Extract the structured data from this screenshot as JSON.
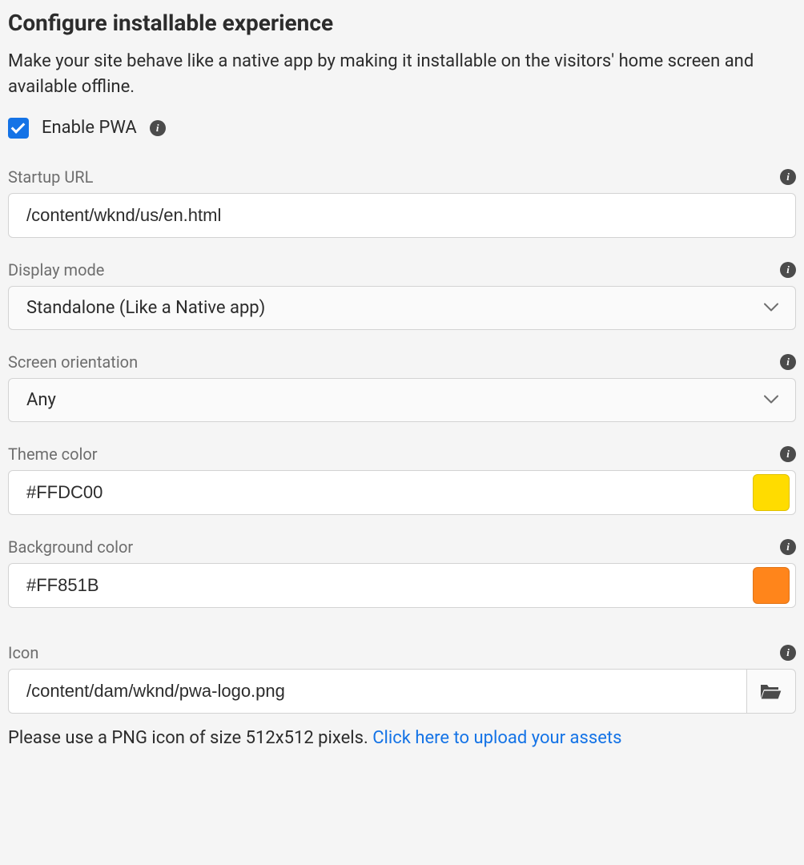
{
  "header": {
    "title": "Configure installable experience",
    "description": "Make your site behave like a native app by making it installable on the visitors' home screen and available offline."
  },
  "enable": {
    "label": "Enable PWA",
    "checked": true
  },
  "fields": {
    "startup_url": {
      "label": "Startup URL",
      "value": "/content/wknd/us/en.html"
    },
    "display_mode": {
      "label": "Display mode",
      "value": "Standalone (Like a Native app)"
    },
    "screen_orientation": {
      "label": "Screen orientation",
      "value": "Any"
    },
    "theme_color": {
      "label": "Theme color",
      "value": "#FFDC00",
      "swatch": "#FFDC00"
    },
    "background_color": {
      "label": "Background color",
      "value": "#FF851B",
      "swatch": "#FF851B"
    },
    "icon": {
      "label": "Icon",
      "value": "/content/dam/wknd/pwa-logo.png",
      "help_prefix": "Please use a PNG icon of size 512x512 pixels. ",
      "help_link": "Click here to upload your assets"
    }
  }
}
